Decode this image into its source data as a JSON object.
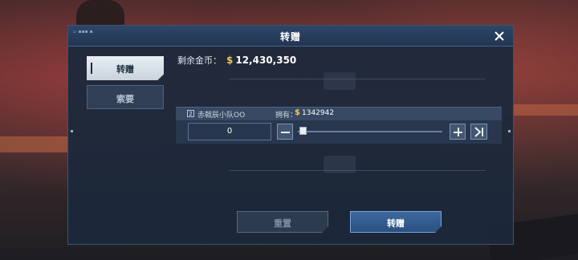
{
  "dialog": {
    "title": "转赠",
    "close_icon": "close-icon"
  },
  "tabs": [
    {
      "label": "转赠",
      "active": true
    },
    {
      "label": "索要",
      "active": false
    }
  ],
  "coins": {
    "label": "剩余金币：",
    "currency_symbol": "$",
    "amount": "12,430,350"
  },
  "member": {
    "index": "2",
    "name": "赤戟辰小队OO",
    "have_label": "拥有：",
    "currency_symbol": "$",
    "have_amount": "1342942"
  },
  "transfer": {
    "quantity": "0",
    "slider_fraction": 0
  },
  "buttons": {
    "reset": "重置",
    "confirm": "转赠"
  },
  "colors": {
    "gold": "#f4c54a",
    "accent": "#3e6a9e",
    "panel": "#1c283a"
  }
}
